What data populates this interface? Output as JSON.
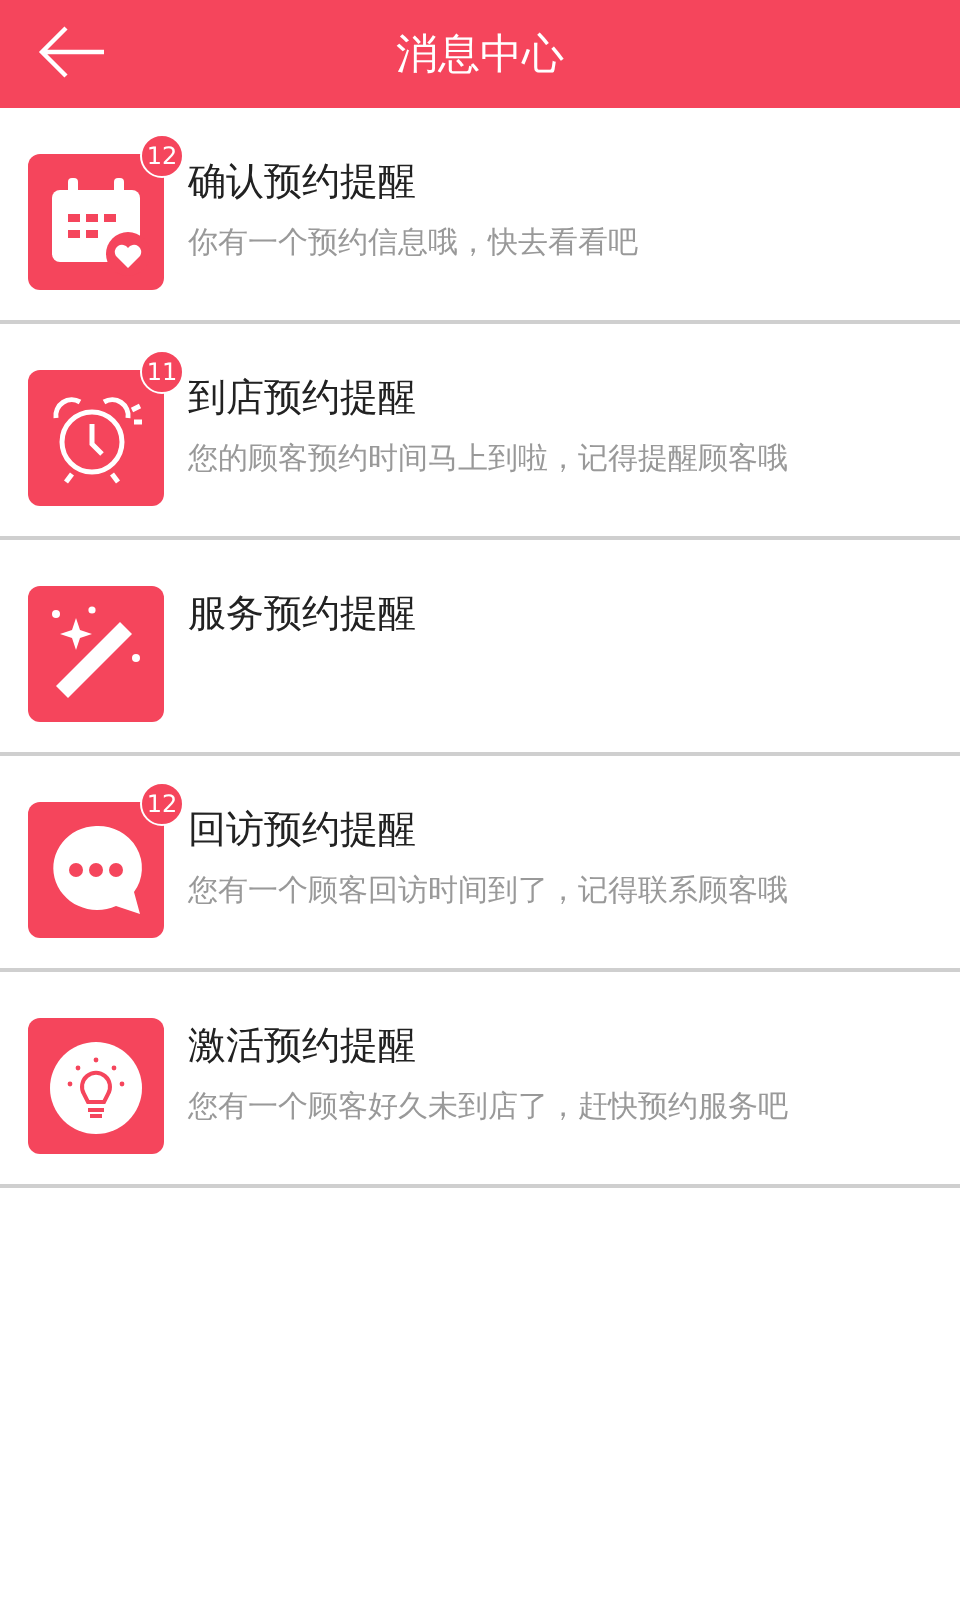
{
  "header": {
    "title": "消息中心"
  },
  "items": [
    {
      "kind": "calendar",
      "badge": "12",
      "title": "确认预约提醒",
      "subtitle": "你有一个预约信息哦，快去看看吧"
    },
    {
      "kind": "alarm",
      "badge": "11",
      "title": "到店预约提醒",
      "subtitle": "您的顾客预约时间马上到啦，记得提醒顾客哦"
    },
    {
      "kind": "wand",
      "title": "服务预约提醒"
    },
    {
      "kind": "chat",
      "badge": "12",
      "title": "回访预约提醒",
      "subtitle": "您有一个顾客回访时间到了，记得联系顾客哦"
    },
    {
      "kind": "bulb",
      "title": "激活预约提醒",
      "subtitle": "您有一个顾客好久未到店了，赶快预约服务吧"
    }
  ]
}
